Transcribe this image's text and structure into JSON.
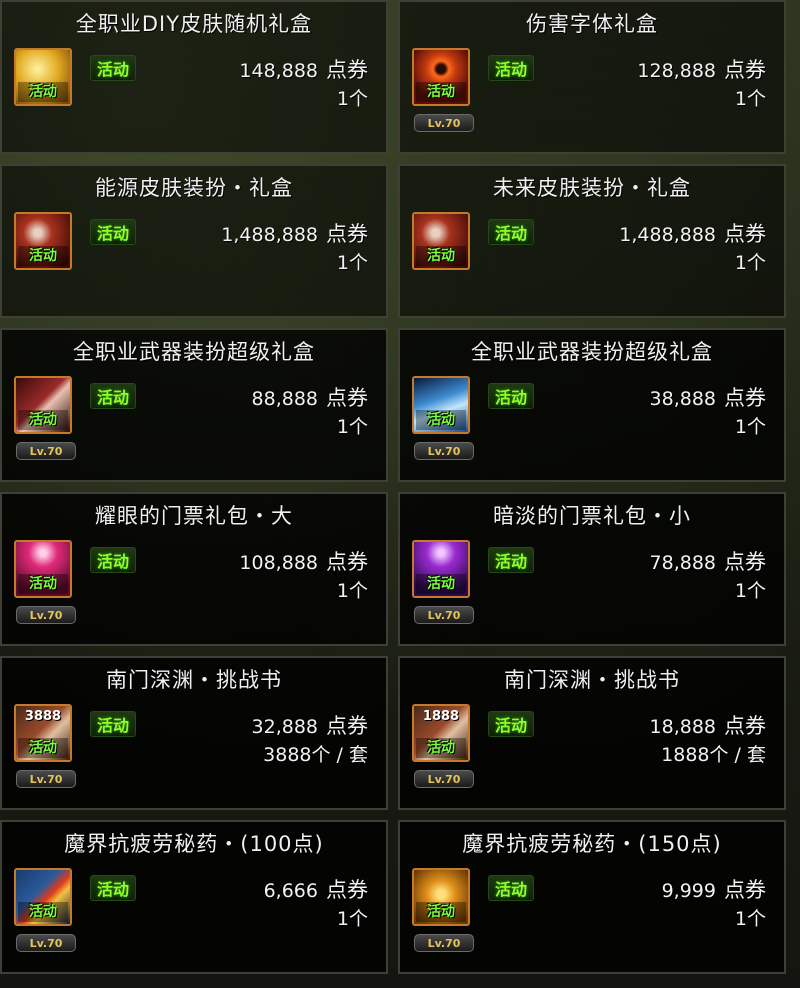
{
  "items": [
    {
      "title": "全职业DIY皮肤随机礼盒",
      "badge": "活动",
      "price": "148,888",
      "unit": "点券",
      "qty": "1个",
      "lv": "",
      "icon": "gold-box-icon",
      "icon_color": "#d9a020",
      "icon_num": ""
    },
    {
      "title": "伤害字体礼盒",
      "badge": "活动",
      "price": "128,888",
      "unit": "点券",
      "qty": "1个",
      "lv": "Lv.70",
      "icon": "fire-ring-icon",
      "icon_color": "#b23a1a",
      "icon_num": ""
    },
    {
      "title": "能源皮肤装扮・礼盒",
      "badge": "活动",
      "price": "1,488,888",
      "unit": "点券",
      "qty": "1个",
      "lv": "",
      "icon": "energy-box-icon",
      "icon_color": "#a8321e",
      "icon_num": ""
    },
    {
      "title": "未来皮肤装扮・礼盒",
      "badge": "活动",
      "price": "1,488,888",
      "unit": "点券",
      "qty": "1个",
      "lv": "",
      "icon": "future-box-icon",
      "icon_color": "#a8321e",
      "icon_num": ""
    },
    {
      "title": "全职业武器装扮超级礼盒",
      "badge": "活动",
      "price": "88,888",
      "unit": "点券",
      "qty": "1个",
      "lv": "Lv.70",
      "icon": "weapon-box-icon",
      "icon_color": "#8a2a2a",
      "icon_num": ""
    },
    {
      "title": "全职业武器装扮超级礼盒",
      "badge": "活动",
      "price": "38,888",
      "unit": "点券",
      "qty": "1个",
      "lv": "Lv.70",
      "icon": "crystal-box-icon",
      "icon_color": "#3c8ad0",
      "icon_num": ""
    },
    {
      "title": "耀眼的门票礼包・大",
      "badge": "活动",
      "price": "108,888",
      "unit": "点券",
      "qty": "1个",
      "lv": "Lv.70",
      "icon": "ticket-pink-icon",
      "icon_color": "#c21a5a",
      "icon_num": ""
    },
    {
      "title": "暗淡的门票礼包・小",
      "badge": "活动",
      "price": "78,888",
      "unit": "点券",
      "qty": "1个",
      "lv": "Lv.70",
      "icon": "ticket-purple-icon",
      "icon_color": "#7a1ab2",
      "icon_num": ""
    },
    {
      "title": "南门深渊・挑战书",
      "badge": "活动",
      "price": "32,888",
      "unit": "点券",
      "qty": "3888个 / 套",
      "lv": "Lv.70",
      "icon": "challenge-book-icon",
      "icon_color": "#9a4a2a",
      "icon_num": "3888"
    },
    {
      "title": "南门深渊・挑战书",
      "badge": "活动",
      "price": "18,888",
      "unit": "点券",
      "qty": "1888个 / 套",
      "lv": "Lv.70",
      "icon": "challenge-book-icon",
      "icon_color": "#9a4a2a",
      "icon_num": "1888"
    },
    {
      "title": "魔界抗疲劳秘药・(100点)",
      "badge": "活动",
      "price": "6,666",
      "unit": "点券",
      "qty": "1个",
      "lv": "Lv.70",
      "icon": "potion-red-icon",
      "icon_color": "#2a5a9a",
      "icon_num": ""
    },
    {
      "title": "魔界抗疲劳秘药・(150点)",
      "badge": "活动",
      "price": "9,999",
      "unit": "点券",
      "qty": "1个",
      "lv": "Lv.70",
      "icon": "potion-gold-icon",
      "icon_color": "#c27a12",
      "icon_num": ""
    }
  ]
}
